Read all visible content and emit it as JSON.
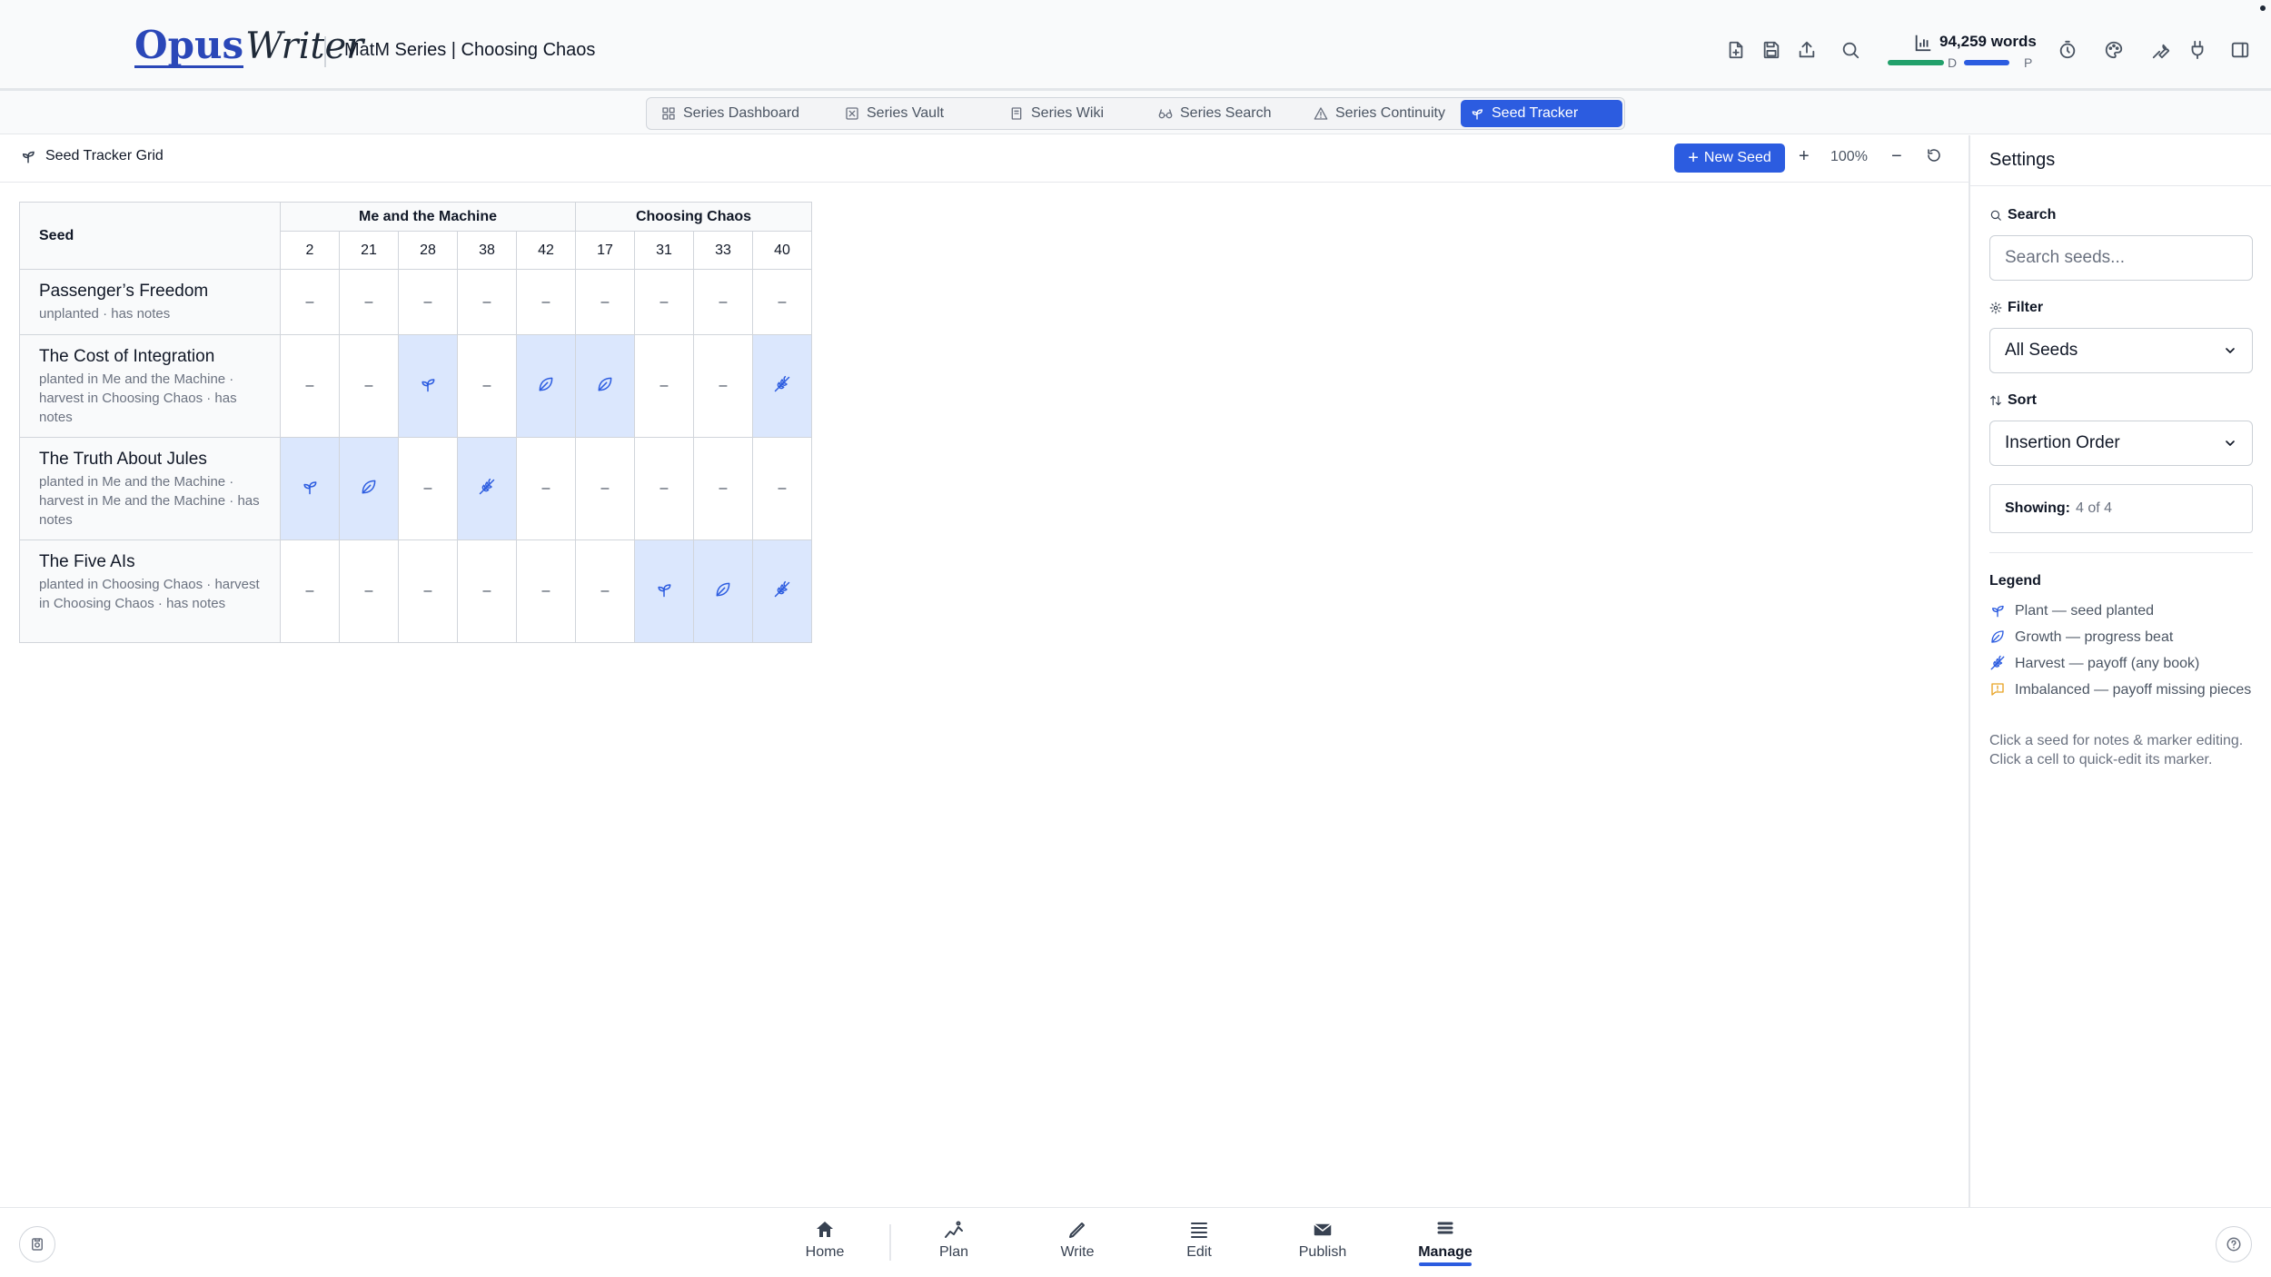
{
  "app": {
    "logo_part1": "Opus",
    "logo_part2": "Writer",
    "document_title": "MatM Series | Choosing Chaos",
    "word_count": "94,259 words",
    "draft_label": "D",
    "publish_label": "P"
  },
  "tabs": [
    {
      "label": "Series Dashboard",
      "icon": "dashboard-icon"
    },
    {
      "label": "Series Vault",
      "icon": "vault-icon"
    },
    {
      "label": "Series Wiki",
      "icon": "wiki-icon"
    },
    {
      "label": "Series Search",
      "icon": "glasses-icon"
    },
    {
      "label": "Series Continuity",
      "icon": "warning-icon"
    },
    {
      "label": "Seed Tracker",
      "icon": "sprout-icon",
      "active": true
    }
  ],
  "toolbar": {
    "title": "Seed Tracker Grid",
    "new_seed_label": "New Seed",
    "zoom_in": "+",
    "zoom_level": "100%",
    "zoom_out": "−"
  },
  "grid": {
    "seed_header": "Seed",
    "books": [
      {
        "title": "Me and the Machine",
        "chapters": [
          "2",
          "21",
          "28",
          "38",
          "42"
        ]
      },
      {
        "title": "Choosing Chaos",
        "chapters": [
          "17",
          "31",
          "33",
          "40"
        ]
      }
    ],
    "empty_marker": "–",
    "seeds": [
      {
        "name": "Passenger’s Freedom",
        "status": "unplanted · has notes",
        "cells": [
          "",
          "",
          "",
          "",
          "",
          "",
          "",
          "",
          ""
        ]
      },
      {
        "name": "The Cost of Integration",
        "status": "planted in Me and the Machine · harvest in Choosing Chaos · has notes",
        "cells": [
          "",
          "",
          "plant",
          "",
          "growth",
          "growth",
          "",
          "",
          "harvest"
        ]
      },
      {
        "name": "The Truth About Jules",
        "status": "planted in Me and the Machine · harvest in Me and the Machine · has notes",
        "cells": [
          "plant",
          "growth",
          "",
          "harvest",
          "",
          "",
          "",
          "",
          ""
        ]
      },
      {
        "name": "The Five AIs",
        "status": "planted in Choosing Chaos · harvest in Choosing Chaos · has notes",
        "cells": [
          "",
          "",
          "",
          "",
          "",
          "",
          "plant",
          "growth",
          "harvest"
        ]
      }
    ]
  },
  "settings": {
    "title": "Settings",
    "search_label": "Search",
    "search_placeholder": "Search seeds...",
    "filter_label": "Filter",
    "filter_value": "All Seeds",
    "sort_label": "Sort",
    "sort_value": "Insertion Order",
    "showing_label": "Showing:",
    "showing_value": "4 of 4",
    "legend_title": "Legend",
    "legend": [
      {
        "icon": "plant-icon",
        "text": "Plant — seed planted"
      },
      {
        "icon": "growth-icon",
        "text": "Growth — progress beat"
      },
      {
        "icon": "harvest-icon",
        "text": "Harvest — payoff (any book)"
      },
      {
        "icon": "imbalanced-icon",
        "text": "Imbalanced — payoff missing pieces"
      }
    ],
    "help_text": "Click a seed for notes & marker editing. Click a cell to quick-edit its marker."
  },
  "bottom_nav": [
    {
      "label": "Home",
      "icon": "home-icon"
    },
    {
      "label": "Plan",
      "icon": "plan-icon"
    },
    {
      "label": "Write",
      "icon": "pen-icon"
    },
    {
      "label": "Edit",
      "icon": "edit-icon"
    },
    {
      "label": "Publish",
      "icon": "mail-icon"
    },
    {
      "label": "Manage",
      "icon": "layers-icon",
      "active": true
    }
  ],
  "colors": {
    "accent": "#2c5ce0",
    "marker_bg": "#dbe7fd",
    "draft_progress": "#22a06b",
    "warning": "#e8a325"
  }
}
